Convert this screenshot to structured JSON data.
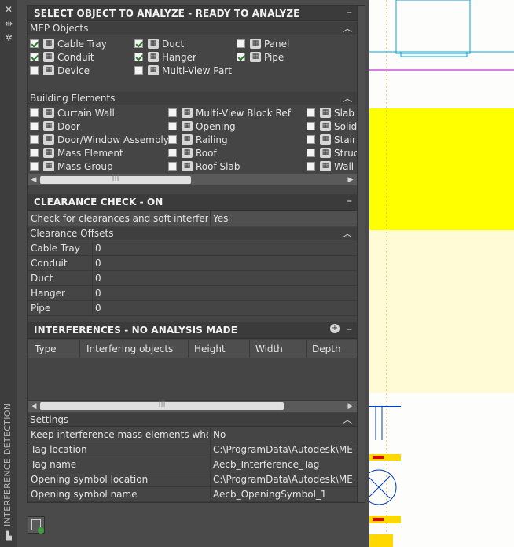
{
  "palette": {
    "vertical_title": "INTERFERENCE DETECTION",
    "close_icon": "close-icon",
    "autohide_icon": "autohide-icon",
    "properties_icon": "properties-icon"
  },
  "select": {
    "title": "SELECT OBJECT TO ANALYZE - READY TO ANALYZE",
    "collapse": "–",
    "mep": {
      "label": "MEP Objects",
      "items": [
        {
          "label": "Cable Tray",
          "checked": true,
          "icon": "cable-tray-icon"
        },
        {
          "label": "Duct",
          "checked": true,
          "icon": "duct-icon"
        },
        {
          "label": "Panel",
          "checked": false,
          "icon": "panel-icon"
        },
        {
          "label": "Conduit",
          "checked": true,
          "icon": "conduit-icon"
        },
        {
          "label": "Hanger",
          "checked": true,
          "icon": "hanger-icon"
        },
        {
          "label": "Pipe",
          "checked": true,
          "icon": "pipe-icon"
        },
        {
          "label": "Device",
          "checked": false,
          "icon": "device-icon"
        },
        {
          "label": "Multi-View Part",
          "checked": false,
          "icon": "multi-view-part-icon"
        }
      ]
    },
    "building": {
      "label": "Building Elements",
      "items": [
        {
          "label": "Curtain Wall",
          "checked": false,
          "icon": "curtain-wall-icon"
        },
        {
          "label": "Multi-View Block Ref",
          "checked": false,
          "icon": "block-ref-icon"
        },
        {
          "label": "Slab",
          "checked": false,
          "icon": "slab-icon"
        },
        {
          "label": "Door",
          "checked": false,
          "icon": "door-icon"
        },
        {
          "label": "Opening",
          "checked": false,
          "icon": "opening-icon"
        },
        {
          "label": "Solid",
          "checked": false,
          "icon": "solid-icon"
        },
        {
          "label": "Door/Window Assembly",
          "checked": false,
          "icon": "door-window-icon"
        },
        {
          "label": "Railing",
          "checked": false,
          "icon": "railing-icon"
        },
        {
          "label": "Stair",
          "checked": false,
          "icon": "stair-icon"
        },
        {
          "label": "Mass Element",
          "checked": false,
          "icon": "mass-element-icon"
        },
        {
          "label": "Roof",
          "checked": false,
          "icon": "roof-icon"
        },
        {
          "label": "Struct",
          "checked": false,
          "icon": "structure-icon"
        },
        {
          "label": "Mass Group",
          "checked": false,
          "icon": "mass-group-icon"
        },
        {
          "label": "Roof Slab",
          "checked": false,
          "icon": "roof-slab-icon"
        },
        {
          "label": "Wall",
          "checked": false,
          "icon": "wall-icon"
        }
      ]
    }
  },
  "clearance": {
    "title": "CLEARANCE CHECK - ON",
    "check_label": "Check for clearances and soft interferenc...",
    "check_value": "Yes",
    "offsets_label": "Clearance Offsets",
    "offsets": [
      {
        "label": "Cable Tray",
        "value": "0"
      },
      {
        "label": "Conduit",
        "value": "0"
      },
      {
        "label": "Duct",
        "value": "0"
      },
      {
        "label": "Hanger",
        "value": "0"
      },
      {
        "label": "Pipe",
        "value": "0"
      }
    ]
  },
  "interferences": {
    "title": "INTERFERENCES - NO ANALYSIS MADE",
    "columns": [
      "Type",
      "Interfering objects",
      "Height",
      "Width",
      "Depth"
    ]
  },
  "settings": {
    "label": "Settings",
    "rows": [
      {
        "label": "Keep interference mass elements when e...",
        "value": "No"
      },
      {
        "label": "Tag location",
        "value": "C:\\ProgramData\\Autodesk\\ME..."
      },
      {
        "label": "Tag name",
        "value": "Aecb_Interference_Tag"
      },
      {
        "label": "Opening symbol location",
        "value": "C:\\ProgramData\\Autodesk\\ME..."
      },
      {
        "label": "Opening symbol name",
        "value": "Aecb_OpeningSymbol_1"
      }
    ]
  },
  "colors": {
    "panel_bg": "#454545",
    "header_bg": "#3b3b3b",
    "canvas_yellow": "#ffff00",
    "canvas_light_yellow": "#fffbd6",
    "cad_cyan": "#00a8d8",
    "cad_magenta": "#b000c8",
    "cad_red": "#e00000"
  }
}
